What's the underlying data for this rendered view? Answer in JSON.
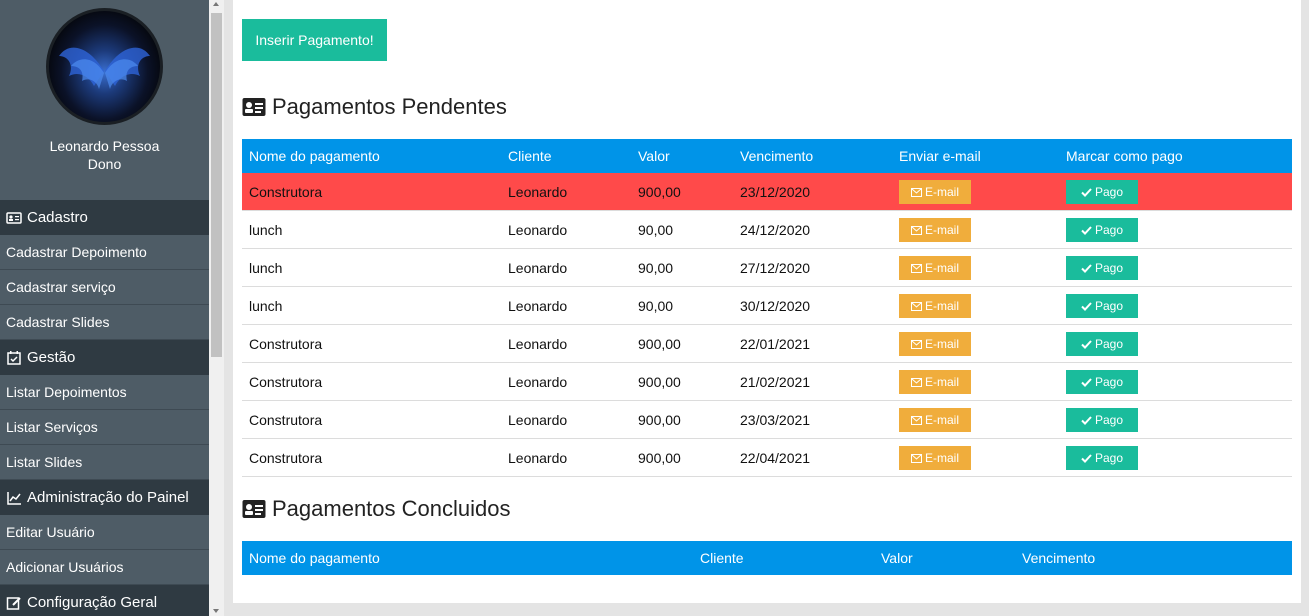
{
  "sidebar": {
    "user_name": "Leonardo Pessoa",
    "user_role": "Dono",
    "sections": [
      {
        "title": "Cadastro",
        "icon": "id-card-icon",
        "items": [
          "Cadastrar Depoimento",
          "Cadastrar serviço",
          "Cadastrar Slides"
        ]
      },
      {
        "title": "Gestão",
        "icon": "calendar-check-icon",
        "items": [
          "Listar Depoimentos",
          "Listar Serviços",
          "Listar Slides"
        ]
      },
      {
        "title": "Administração do Painel",
        "icon": "line-chart-icon",
        "items": [
          "Editar Usuário",
          "Adicionar Usuários"
        ]
      },
      {
        "title": "Configuração Geral",
        "icon": "edit-icon",
        "items": []
      }
    ]
  },
  "main": {
    "insert_button": "Inserir Pagamento!",
    "pending": {
      "title": "Pagamentos Pendentes",
      "headers": [
        "Nome do pagamento",
        "Cliente",
        "Valor",
        "Vencimento",
        "Enviar e-mail",
        "Marcar como pago"
      ],
      "email_label": "E-mail",
      "paid_label": "Pago",
      "rows": [
        {
          "name": "Construtora",
          "client": "Leonardo",
          "value": "900,00",
          "due": "23/12/2020",
          "overdue": true
        },
        {
          "name": "lunch",
          "client": "Leonardo",
          "value": "90,00",
          "due": "24/12/2020",
          "overdue": false
        },
        {
          "name": "lunch",
          "client": "Leonardo",
          "value": "90,00",
          "due": "27/12/2020",
          "overdue": false
        },
        {
          "name": "lunch",
          "client": "Leonardo",
          "value": "90,00",
          "due": "30/12/2020",
          "overdue": false
        },
        {
          "name": "Construtora",
          "client": "Leonardo",
          "value": "900,00",
          "due": "22/01/2021",
          "overdue": false
        },
        {
          "name": "Construtora",
          "client": "Leonardo",
          "value": "900,00",
          "due": "21/02/2021",
          "overdue": false
        },
        {
          "name": "Construtora",
          "client": "Leonardo",
          "value": "900,00",
          "due": "23/03/2021",
          "overdue": false
        },
        {
          "name": "Construtora",
          "client": "Leonardo",
          "value": "900,00",
          "due": "22/04/2021",
          "overdue": false
        }
      ]
    },
    "done": {
      "title": "Pagamentos Concluidos",
      "headers": [
        "Nome do pagamento",
        "Cliente",
        "Valor",
        "Vencimento"
      ]
    }
  },
  "colors": {
    "sidebar_bg": "#4e5c66",
    "sidebar_header_bg": "#2f3a42",
    "table_header_bg": "#0094e8",
    "overdue_row": "#ff4a4a",
    "email_button": "#f0ad3c",
    "accent_green": "#1abc9c"
  }
}
